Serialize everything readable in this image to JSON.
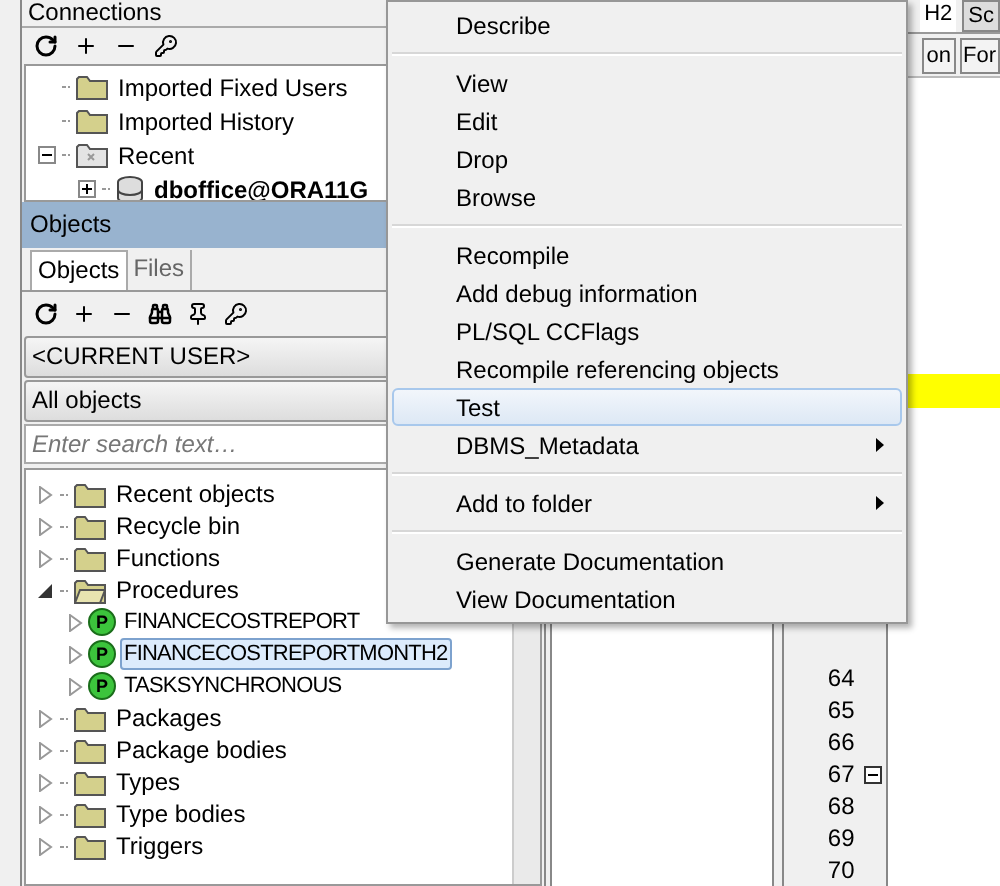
{
  "connections": {
    "title": "Connections",
    "items": [
      {
        "label": "Imported Fixed Users",
        "kind": "folder"
      },
      {
        "label": "Imported History",
        "kind": "folder"
      },
      {
        "label": "Recent",
        "kind": "recent",
        "expanded": true,
        "children": [
          {
            "label": "dboffice@ORA11G",
            "kind": "database",
            "expanded": false
          }
        ]
      }
    ]
  },
  "objects": {
    "title": "Objects",
    "tabs": [
      {
        "label": "Objects",
        "selected": true
      },
      {
        "label": "Files",
        "selected": false
      }
    ],
    "owner": "<CURRENT USER>",
    "filter": "All objects",
    "search": {
      "placeholder": "Enter search text…"
    },
    "tree": [
      {
        "label": "Recent objects",
        "kind": "folder",
        "expanded": false,
        "selected": false
      },
      {
        "label": "Recycle bin",
        "kind": "folder",
        "expanded": false,
        "selected": false
      },
      {
        "label": "Functions",
        "kind": "folder",
        "expanded": false,
        "selected": false
      },
      {
        "label": "Procedures",
        "kind": "folder",
        "expanded": true,
        "selected": false,
        "children": [
          {
            "label": "FINANCECOSTREPORT",
            "kind": "procedure",
            "icon_letter": "P",
            "expanded": false,
            "selected": false
          },
          {
            "label": "FINANCECOSTREPORTMONTH2",
            "kind": "procedure",
            "icon_letter": "P",
            "expanded": false,
            "selected": true
          },
          {
            "label": "TASKSYNCHRONOUS",
            "kind": "procedure",
            "icon_letter": "P",
            "expanded": false,
            "selected": false
          }
        ]
      },
      {
        "label": "Packages",
        "kind": "folder",
        "expanded": false,
        "selected": false
      },
      {
        "label": "Package bodies",
        "kind": "folder",
        "expanded": false,
        "selected": false
      },
      {
        "label": "Types",
        "kind": "folder",
        "expanded": false,
        "selected": false
      },
      {
        "label": "Type bodies",
        "kind": "folder",
        "expanded": false,
        "selected": false
      },
      {
        "label": "Triggers",
        "kind": "folder",
        "expanded": false,
        "selected": false
      }
    ]
  },
  "context_menu": {
    "groups": [
      [
        {
          "label": "Describe",
          "selected": false,
          "submenu": false
        }
      ],
      [
        {
          "label": "View",
          "selected": false,
          "submenu": false
        },
        {
          "label": "Edit",
          "selected": false,
          "submenu": false
        },
        {
          "label": "Drop",
          "selected": false,
          "submenu": false
        },
        {
          "label": "Browse",
          "selected": false,
          "submenu": false
        }
      ],
      [
        {
          "label": "Recompile",
          "selected": false,
          "submenu": false
        },
        {
          "label": "Add debug information",
          "selected": false,
          "submenu": false
        },
        {
          "label": "PL/SQL CCFlags",
          "selected": false,
          "submenu": false
        },
        {
          "label": "Recompile referencing objects",
          "selected": false,
          "submenu": false
        },
        {
          "label": "Test",
          "selected": true,
          "submenu": false
        },
        {
          "label": "DBMS_Metadata",
          "selected": false,
          "submenu": true
        }
      ],
      [
        {
          "label": "Add to folder",
          "selected": false,
          "submenu": true
        }
      ],
      [
        {
          "label": "Generate Documentation",
          "selected": false,
          "submenu": false
        },
        {
          "label": "View Documentation",
          "selected": false,
          "submenu": false
        }
      ]
    ]
  },
  "editor": {
    "tabs": [
      {
        "label": "H2",
        "selected": true
      },
      {
        "label": "Sc",
        "selected": false
      }
    ],
    "buttons": [
      "on",
      "For"
    ],
    "lines": [
      {
        "number": "64",
        "fold": false
      },
      {
        "number": "65",
        "fold": false
      },
      {
        "number": "66",
        "fold": false
      },
      {
        "number": "67",
        "fold": true
      },
      {
        "number": "68",
        "fold": false
      },
      {
        "number": "69",
        "fold": false
      },
      {
        "number": "70",
        "fold": false
      }
    ]
  }
}
